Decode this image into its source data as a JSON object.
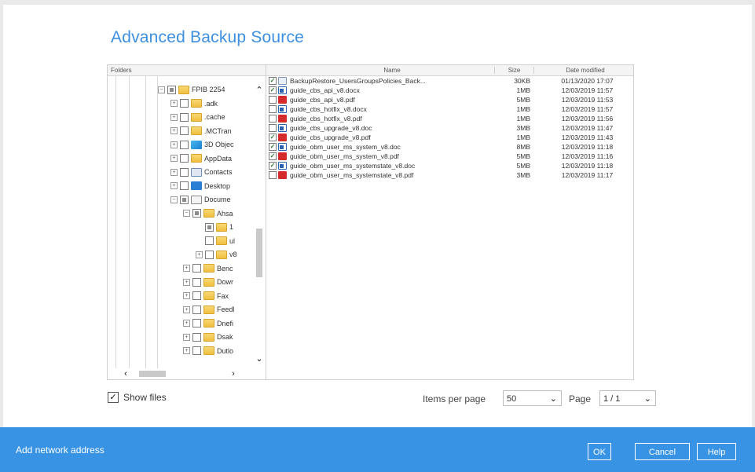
{
  "dialog": {
    "title": "Advanced Backup Source"
  },
  "tree": {
    "header": "Folders",
    "nodes": [
      {
        "label": "FPIB 2254",
        "expand": "⊟",
        "check": "partial",
        "icon": "folder"
      },
      {
        "label": ".adk",
        "expand": "⊞",
        "check": "none",
        "icon": "folder"
      },
      {
        "label": ".cache",
        "expand": "⊞",
        "check": "none",
        "icon": "folder"
      },
      {
        "label": ".MCTran",
        "expand": "⊞",
        "check": "none",
        "icon": "folder"
      },
      {
        "label": "3D Objec",
        "expand": "⊞",
        "check": "none",
        "icon": "obj3d"
      },
      {
        "label": "AppData",
        "expand": "⊞",
        "check": "none",
        "icon": "folder"
      },
      {
        "label": "Contacts",
        "expand": "⊞",
        "check": "none",
        "icon": "contacts"
      },
      {
        "label": "Desktop",
        "expand": "⊞",
        "check": "none",
        "icon": "desktop"
      },
      {
        "label": "Docume",
        "expand": "⊟",
        "check": "partial",
        "icon": "docs"
      },
      {
        "label": "Ahsa",
        "expand": "⊟",
        "check": "partial",
        "icon": "folder"
      },
      {
        "label": "1",
        "expand": "",
        "check": "partial",
        "icon": "folder"
      },
      {
        "label": "ul",
        "expand": "",
        "check": "none",
        "icon": "folder"
      },
      {
        "label": "v8",
        "expand": "⊞",
        "check": "none",
        "icon": "folder"
      },
      {
        "label": "Benc",
        "expand": "⊞",
        "check": "none",
        "icon": "folder"
      },
      {
        "label": "Dowr",
        "expand": "⊞",
        "check": "none",
        "icon": "folder"
      },
      {
        "label": "Fax",
        "expand": "⊞",
        "check": "none",
        "icon": "folder"
      },
      {
        "label": "Feedl",
        "expand": "⊞",
        "check": "none",
        "icon": "folder"
      },
      {
        "label": "Dnefi",
        "expand": "⊞",
        "check": "none",
        "icon": "folder"
      },
      {
        "label": "Dsak",
        "expand": "⊞",
        "check": "none",
        "icon": "folder"
      },
      {
        "label": "Dutlo",
        "expand": "⊞",
        "check": "none",
        "icon": "folder"
      }
    ]
  },
  "files": {
    "columns": {
      "name": "Name",
      "size": "Size",
      "date": "Date modified"
    },
    "rows": [
      {
        "checked": true,
        "type": "bak",
        "name": "BackupRestore_UsersGroupsPolicies_Back...",
        "size": "30KB",
        "date": "01/13/2020 17:07"
      },
      {
        "checked": true,
        "type": "doc",
        "name": "guide_cbs_api_v8.docx",
        "size": "1MB",
        "date": "12/03/2019 11:57"
      },
      {
        "checked": false,
        "type": "pdf",
        "name": "guide_cbs_api_v8.pdf",
        "size": "5MB",
        "date": "12/03/2019 11:53"
      },
      {
        "checked": false,
        "type": "doc",
        "name": "guide_cbs_hotfix_v8.docx",
        "size": "1MB",
        "date": "12/03/2019 11:57"
      },
      {
        "checked": false,
        "type": "pdf",
        "name": "guide_cbs_hotfix_v8.pdf",
        "size": "1MB",
        "date": "12/03/2019 11:56"
      },
      {
        "checked": false,
        "type": "doc",
        "name": "guide_cbs_upgrade_v8.doc",
        "size": "3MB",
        "date": "12/03/2019 11:47"
      },
      {
        "checked": true,
        "type": "pdf",
        "name": "guide_cbs_upgrade_v8.pdf",
        "size": "1MB",
        "date": "12/03/2019 11:43"
      },
      {
        "checked": true,
        "type": "doc",
        "name": "guide_obm_user_ms_system_v8.doc",
        "size": "8MB",
        "date": "12/03/2019 11:18"
      },
      {
        "checked": true,
        "type": "pdf",
        "name": "guide_obm_user_ms_system_v8.pdf",
        "size": "5MB",
        "date": "12/03/2019 11:16"
      },
      {
        "checked": true,
        "type": "doc",
        "name": "guide_obm_user_ms_systemstate_v8.doc",
        "size": "5MB",
        "date": "12/03/2019 11:18"
      },
      {
        "checked": false,
        "type": "pdf",
        "name": "guide_obm_user_ms_systemstate_v8.pdf",
        "size": "3MB",
        "date": "12/03/2019 11:17"
      }
    ]
  },
  "options": {
    "show_files_label": "Show files",
    "show_files_checked": true,
    "items_per_page_label": "Items per page",
    "items_per_page_value": "50",
    "page_label": "Page",
    "page_value": "1 / 1"
  },
  "footer": {
    "network_link": "Add network address",
    "ok": "OK",
    "cancel": "Cancel",
    "help": "Help"
  },
  "colors": {
    "accent": "#3893e5",
    "title": "#3d8fe0"
  }
}
